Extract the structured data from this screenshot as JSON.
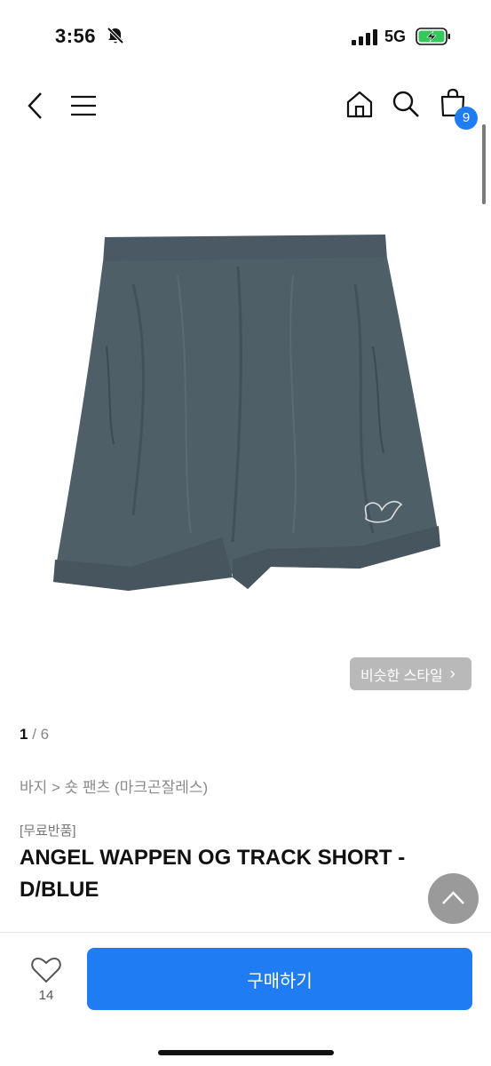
{
  "status_bar": {
    "time": "3:56",
    "network": "5G",
    "icons": [
      "bell-slash-icon",
      "signal-icon",
      "battery-charging-icon"
    ],
    "battery_color": "#34c759"
  },
  "nav": {
    "icons": [
      "back-chevron-icon",
      "hamburger-menu-icon",
      "home-icon",
      "search-icon",
      "shopping-bag-icon"
    ],
    "cart_count": "9",
    "accent_color": "#1f7cf2"
  },
  "product": {
    "similar_style_label": "비슷한 스타일",
    "pager_current": "1",
    "pager_total": " / 6",
    "breadcrumb": "바지 > 숏 팬츠 (마크곤잘레스)",
    "tag": "[무료반품]",
    "title": "ANGEL WAPPEN OG TRACK SHORT - D/BLUE",
    "image_color": "#4f5f68"
  },
  "bottom_bar": {
    "like_count": "14",
    "buy_label": "구매하기"
  }
}
